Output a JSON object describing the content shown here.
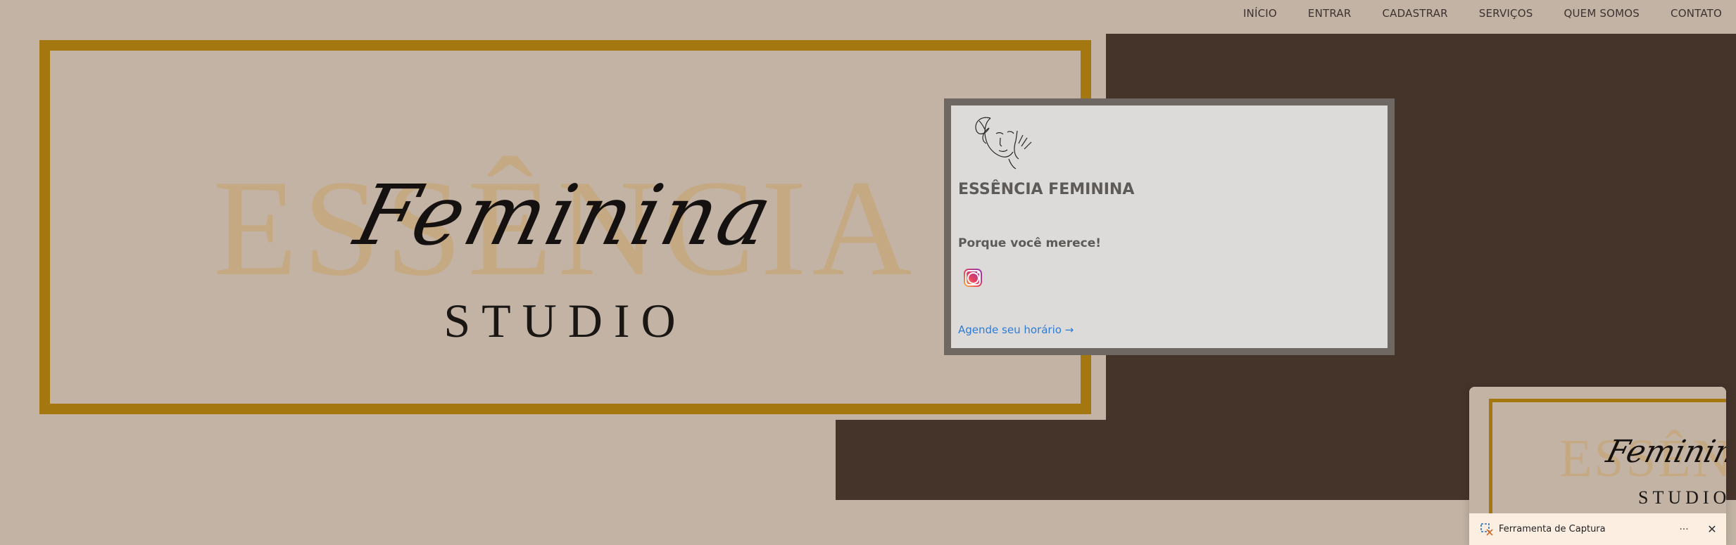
{
  "nav": {
    "items": [
      "INÍCIO",
      "ENTRAR",
      "CADASTRAR",
      "SERVIÇOS",
      "QUEM SOMOS",
      "CONTATO"
    ]
  },
  "hero": {
    "big_word": "ESSÊNCIA",
    "script_word": "Feminina",
    "studio_word": "STUDIO"
  },
  "card": {
    "logo_icon": "butterfly-woman-face-icon",
    "title": "ESSÊNCIA FEMININA",
    "subtitle": "Porque você merece!",
    "social_icon": "instagram-icon",
    "link": "Agende seu horário →"
  },
  "toast": {
    "app_icon": "snipping-tool-icon",
    "label": "Ferramenta de Captura",
    "more": "···",
    "close": "✕"
  },
  "colors": {
    "background": "#c2b3a4",
    "dark_brown": "#45342a",
    "gold_frame": "#a47710",
    "faded_word": "#c5a982",
    "card_border": "#6e6762",
    "card_bg": "#dcdbda",
    "link": "#2f7bd4"
  }
}
